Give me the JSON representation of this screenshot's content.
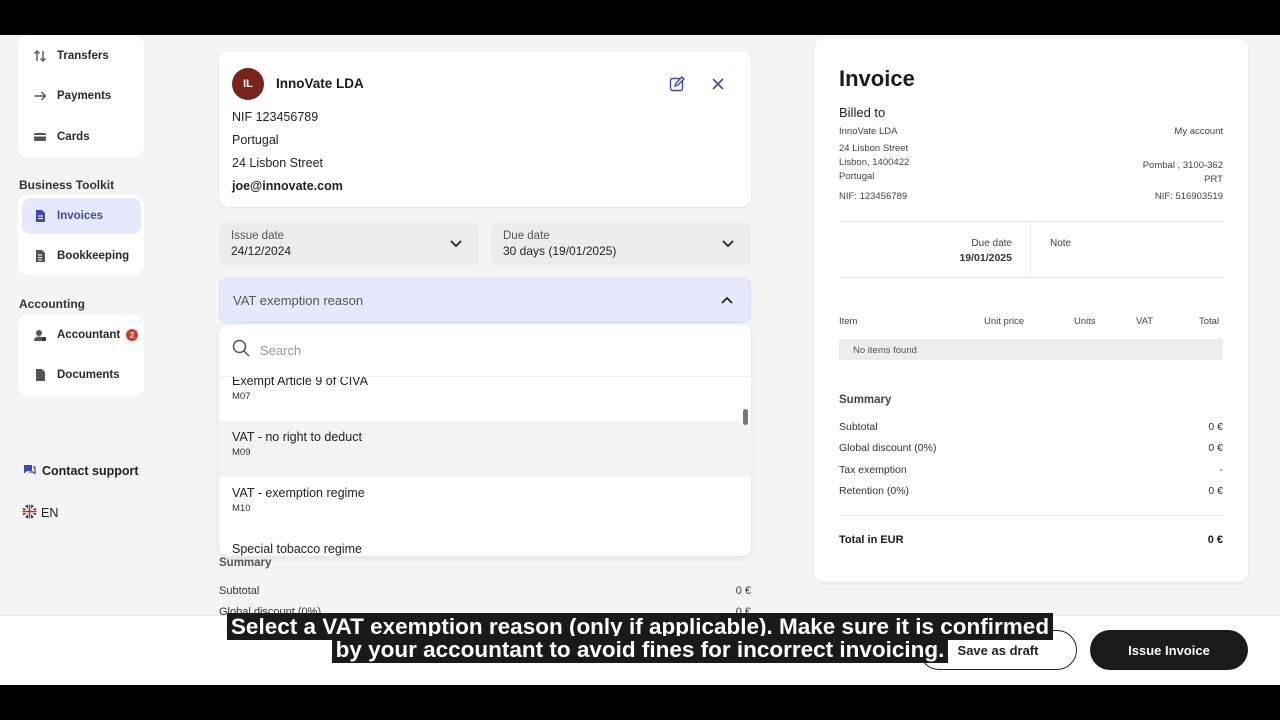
{
  "sidebar": {
    "top_items": [
      {
        "label": "Transfers",
        "icon": "transfer-arrows-icon"
      },
      {
        "label": "Payments",
        "icon": "arrow-right-icon"
      },
      {
        "label": "Cards",
        "icon": "card-icon"
      }
    ],
    "business_label": "Business Toolkit",
    "business_items": [
      {
        "label": "Invoices",
        "icon": "invoice-icon",
        "active": true
      },
      {
        "label": "Bookkeeping",
        "icon": "bookkeeping-icon"
      }
    ],
    "accounting_label": "Accounting",
    "accounting_items": [
      {
        "label": "Accountant",
        "icon": "accountant-icon",
        "badge": "2"
      },
      {
        "label": "Documents",
        "icon": "document-icon"
      }
    ],
    "contact_support": "Contact support",
    "language": "EN"
  },
  "client": {
    "initials": "IL",
    "name": "InnoVate LDA",
    "nif": "NIF 123456789",
    "country": "Portugal",
    "street": "24 Lisbon Street",
    "email": "joe@innovate.com"
  },
  "issue_date": {
    "label": "Issue date",
    "value": "24/12/2024"
  },
  "due_date": {
    "label": "Due date",
    "value": "30 days (19/01/2025)"
  },
  "vat_exemption": {
    "placeholder": "VAT exemption reason",
    "search_placeholder": "Search",
    "options": [
      {
        "label": "Exempt Article 9 of CIVA",
        "code": "M07"
      },
      {
        "label": "VAT - no right to deduct",
        "code": "M09"
      },
      {
        "label": "VAT - exemption regime",
        "code": "M10"
      },
      {
        "label": "Special tobacco regime",
        "code": ""
      }
    ]
  },
  "left_summary": {
    "title": "Summary",
    "subtotal_label": "Subtotal",
    "subtotal_value": "0 €",
    "discount_label": "Global discount (0%)",
    "discount_value": "0 €"
  },
  "invoice": {
    "title": "Invoice",
    "billed_to": "Billed to",
    "client_name": "InnoVate LDA",
    "client_street": "24 Lisbon Street",
    "client_city": "Lisbon, 1400422",
    "client_country": "Portugal",
    "client_nif": "NIF: 123456789",
    "my_account": "My account",
    "my_city": "Pombal , 3100-362",
    "my_country": "PRT",
    "my_nif": "NIF: 516903519",
    "due_label": "Due date",
    "due_value": "19/01/2025",
    "note_label": "Note",
    "columns": [
      "Item",
      "Unit price",
      "Units",
      "VAT",
      "Total"
    ],
    "no_items": "No items found",
    "summary_title": "Summary",
    "rows": [
      {
        "label": "Subtotal",
        "value": "0 €"
      },
      {
        "label": "Global discount (0%)",
        "value": "0 €"
      },
      {
        "label": "Tax exemption",
        "value": "-"
      },
      {
        "label": "Retention (0%)",
        "value": "0 €"
      }
    ],
    "total_label": "Total in EUR",
    "total_value": "0 €"
  },
  "actions": {
    "save_draft": "Save as draft",
    "issue_invoice": "Issue Invoice"
  },
  "caption": {
    "line1": "Select a VAT exemption reason (only if applicable). Make sure it is confirmed",
    "line2": "by your accountant to avoid fines for incorrect invoicing."
  }
}
